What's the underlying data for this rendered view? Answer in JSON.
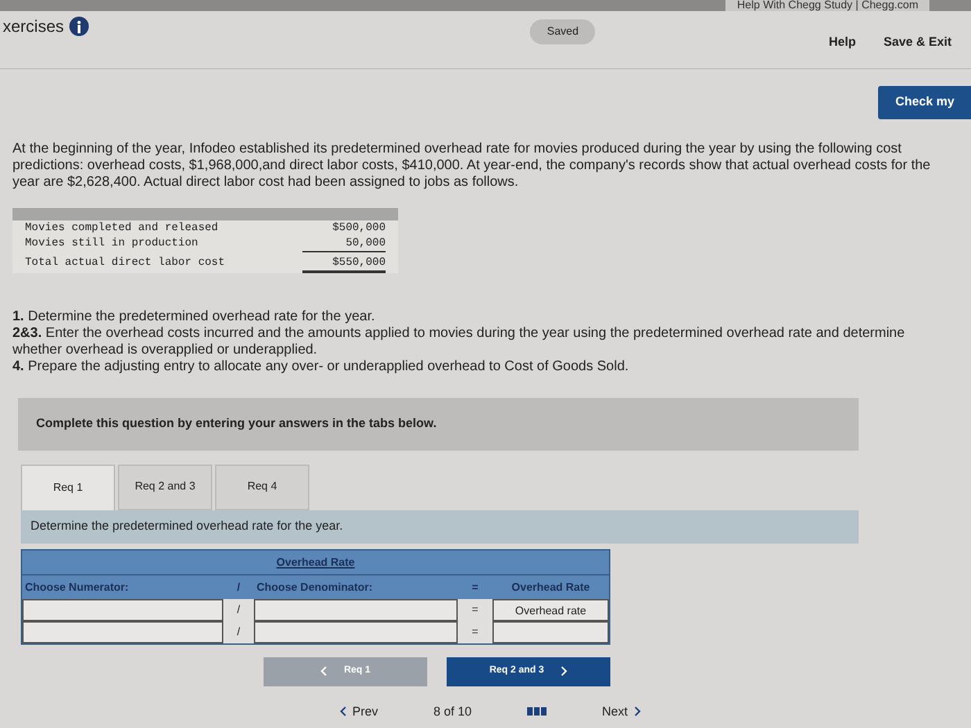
{
  "browser_tab": {
    "title": "Help With Chegg Study | Chegg.com"
  },
  "header": {
    "title": "xercises",
    "status": "Saved",
    "links": [
      "Help",
      "Save & Exit"
    ]
  },
  "check_button": "Check my",
  "problem": "At the beginning of the year, Infodeo established its predetermined overhead rate for movies produced during the year by using the following cost predictions: overhead costs, $1,968,000,and direct labor costs, $410,000. At year-end, the company's records show that actual overhead costs for the year are $2,628,400. Actual direct labor cost had been assigned to jobs as follows.",
  "cost_table": [
    {
      "label": "Movies completed and released",
      "amount": "$500,000"
    },
    {
      "label": "Movies still in production",
      "amount": "50,000"
    },
    {
      "label": "Total actual direct labor cost",
      "amount": "$550,000"
    }
  ],
  "requirements": [
    "**1.** Determine the predetermined overhead rate for the year.",
    "**2&3.** Enter the overhead costs incurred and the amounts applied to movies during the year using the predetermined overhead rate and determine whether overhead is overapplied or underapplied.",
    "**4.** Prepare the adjusting entry to allocate any over- or underapplied overhead to Cost of Goods Sold."
  ],
  "instruction": "Complete this question by entering your answers in the tabs below.",
  "tabs": [
    {
      "label": "Req 1",
      "selected": true
    },
    {
      "label": "Req 2 and 3",
      "selected": false
    },
    {
      "label": "Req 4",
      "selected": false
    }
  ],
  "task": "Determine the predetermined overhead rate for the year.",
  "rate_table": {
    "title": "Overhead Rate",
    "columns": [
      "Choose Numerator:",
      "/",
      "Choose Denominator:",
      "=",
      "Overhead Rate"
    ],
    "rows": [
      {
        "divide": "/",
        "equals": "=",
        "result": "Overhead rate"
      },
      {
        "divide": "/",
        "equals": "="
      }
    ]
  },
  "nav_buttons": [
    {
      "label": "Req 1",
      "kind": "prev",
      "disabled": true
    },
    {
      "label": "Req 2 and 3",
      "kind": "next",
      "disabled": false
    }
  ],
  "pager": {
    "prev": "Prev",
    "position": "8 of 10",
    "next": "Next"
  }
}
